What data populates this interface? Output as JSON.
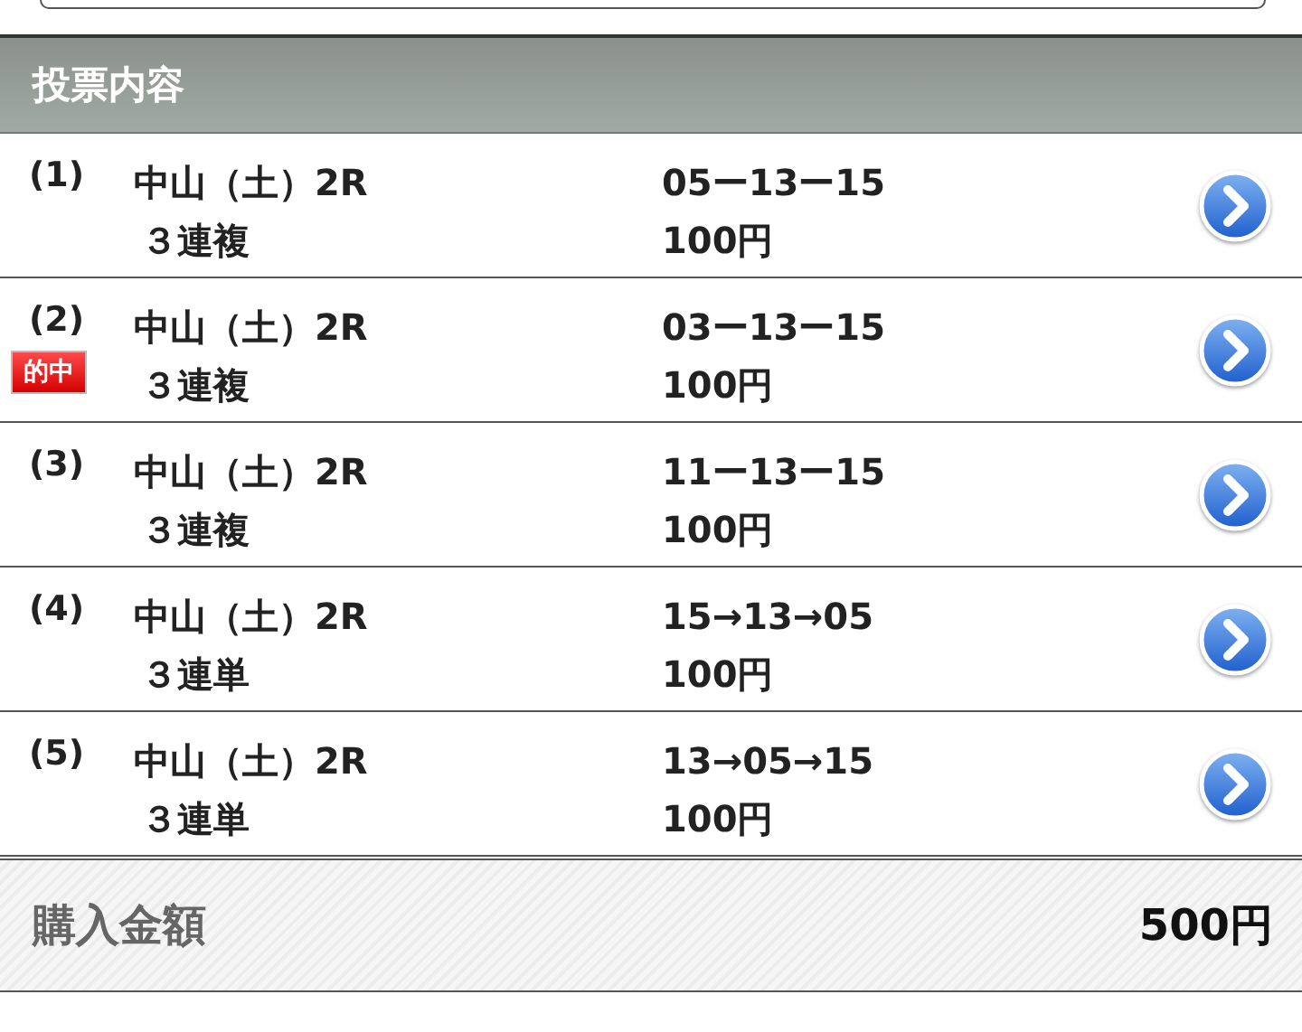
{
  "section_header": {
    "title": "投票内容"
  },
  "bets": [
    {
      "number": "(1)",
      "hit": false,
      "race": "中山（土）2R",
      "bet_type": "３連複",
      "combination": "05ー13ー15",
      "amount": "100円"
    },
    {
      "number": "(2)",
      "hit": true,
      "hit_label": "的中",
      "race": "中山（土）2R",
      "bet_type": "３連複",
      "combination": "03ー13ー15",
      "amount": "100円"
    },
    {
      "number": "(3)",
      "hit": false,
      "race": "中山（土）2R",
      "bet_type": "３連複",
      "combination": "11ー13ー15",
      "amount": "100円"
    },
    {
      "number": "(4)",
      "hit": false,
      "race": "中山（土）2R",
      "bet_type": "３連単",
      "combination": "15→13→05",
      "amount": "100円"
    },
    {
      "number": "(5)",
      "hit": false,
      "race": "中山（土）2R",
      "bet_type": "３連単",
      "combination": "13→05→15",
      "amount": "100円"
    }
  ],
  "total": {
    "label": "購入金額",
    "amount": "500円"
  }
}
